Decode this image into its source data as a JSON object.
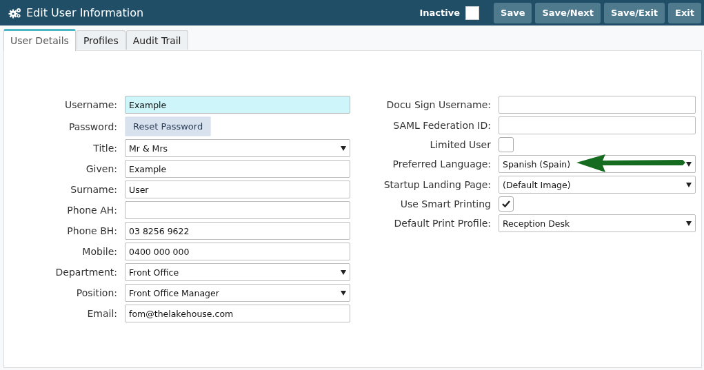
{
  "header": {
    "title": "Edit User Information",
    "inactive": {
      "label": "Inactive",
      "checked": false
    },
    "buttons": [
      "Save",
      "Save/Next",
      "Save/Exit",
      "Exit"
    ]
  },
  "tabs": [
    {
      "label": "User Details",
      "selected": true
    },
    {
      "label": "Profiles",
      "selected": false
    },
    {
      "label": "Audit Trail",
      "selected": false
    }
  ],
  "left_fields": [
    {
      "kind": "text",
      "label": "Username:",
      "value": "Example",
      "focused": true
    },
    {
      "kind": "button",
      "label": "Password:",
      "value": "Reset Password"
    },
    {
      "kind": "select",
      "label": "Title:",
      "value": "Mr & Mrs",
      "focused": false
    },
    {
      "kind": "text",
      "label": "Given:",
      "value": "Example",
      "focused": false
    },
    {
      "kind": "text",
      "label": "Surname:",
      "value": "User",
      "focused": false
    },
    {
      "kind": "text",
      "label": "Phone AH:",
      "focused": false
    },
    {
      "kind": "text",
      "label": "Phone BH:",
      "value": "03 8256 9622",
      "focused": false
    },
    {
      "kind": "text",
      "label": "Mobile:",
      "value": "0400 000 000",
      "focused": false
    },
    {
      "kind": "select",
      "label": "Department:",
      "value": "Front Office",
      "focused": false
    },
    {
      "kind": "select",
      "label": "Position:",
      "value": "Front Office Manager",
      "focused": false
    },
    {
      "kind": "text",
      "label": "Email:",
      "value": "fom@thelakehouse.com",
      "focused": false
    }
  ],
  "right_fields": [
    {
      "kind": "text",
      "label": "Docu Sign Username:",
      "focused": false
    },
    {
      "kind": "text",
      "label": "SAML Federation ID:",
      "focused": false
    },
    {
      "kind": "checkbox",
      "label": "Limited User",
      "checked": false
    },
    {
      "kind": "select",
      "label": "Preferred Language:",
      "value": "Spanish (Spain)",
      "focused": false,
      "annotated": true
    },
    {
      "kind": "select",
      "label": "Startup Landing Page:",
      "value": "(Default Image)",
      "focused": false
    },
    {
      "kind": "checkbox",
      "label": "Use Smart Printing",
      "checked": true
    },
    {
      "kind": "select",
      "label": "Default Print Profile:",
      "value": "Reception Desk",
      "focused": false
    }
  ]
}
